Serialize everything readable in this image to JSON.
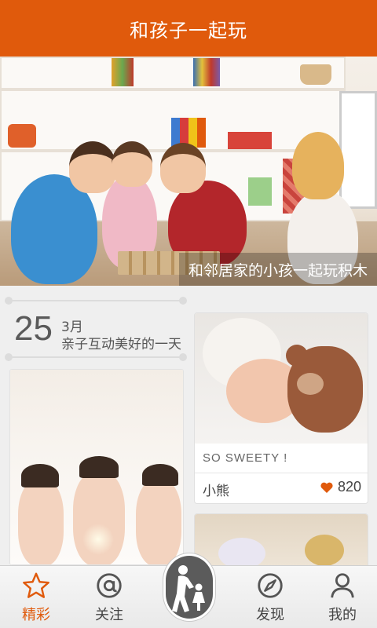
{
  "header": {
    "title": "和孩子一起玩"
  },
  "hero": {
    "caption": "和邻居家的小孩一起玩积木"
  },
  "feed": {
    "date": {
      "day": "25",
      "month": "3月",
      "description": "亲子互动美好的一天"
    },
    "featured": {
      "caption": "SO SWEETY !",
      "name": "小熊",
      "likes": "820"
    }
  },
  "tabs": [
    {
      "label": "精彩",
      "icon": "star-icon",
      "active": true
    },
    {
      "label": "关注",
      "icon": "at-icon",
      "active": false
    },
    {
      "label": "发现",
      "icon": "compass-icon",
      "active": false
    },
    {
      "label": "我的",
      "icon": "person-icon",
      "active": false
    }
  ],
  "colors": {
    "accent": "#e05a0c",
    "heart": "#e05a0c"
  }
}
